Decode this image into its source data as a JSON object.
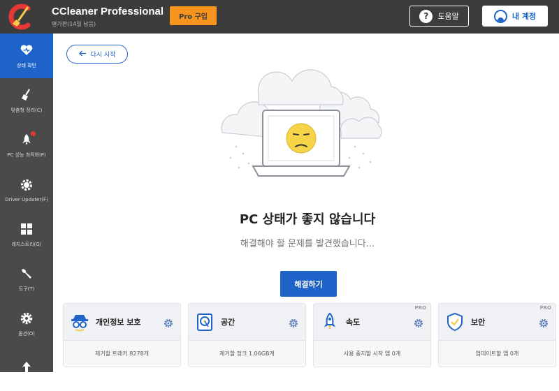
{
  "header": {
    "app_title": "CCleaner Professional",
    "subtitle": "평가판(14일 남음)",
    "pro_button": "Pro 구입",
    "help_button": "도움말",
    "account_button": "내 계정"
  },
  "sidebar": {
    "items": [
      {
        "label": "상태 확인",
        "icon": "heart-icon",
        "active": true
      },
      {
        "label": "맞춤형 정리(C)",
        "icon": "broom-icon"
      },
      {
        "label": "PC 성능 최적화(P)",
        "icon": "rocket-icon"
      },
      {
        "label": "Driver Updater(F)",
        "icon": "gear-chip-icon"
      },
      {
        "label": "레지스트리(G)",
        "icon": "grid-icon"
      },
      {
        "label": "도구(T)",
        "icon": "wrench-icon"
      },
      {
        "label": "옵션(O)",
        "icon": "settings-icon"
      },
      {
        "label": "",
        "icon": "upgrade-arrow-icon"
      }
    ]
  },
  "main": {
    "restart_button": "다시 시작",
    "status_title": "PC 상태가 좋지 않습니다",
    "status_subtitle": "해결해야 할 문제를 발견했습니다...",
    "fix_button": "해결하기"
  },
  "cards": [
    {
      "title": "개인정보 보호",
      "detail": "제거할 트래커 8278개",
      "pro": ""
    },
    {
      "title": "공간",
      "detail": "제거할 정크 1.06GB개",
      "pro": ""
    },
    {
      "title": "속도",
      "detail": "사용 중지할 시작 앱 0개",
      "pro": "PRO"
    },
    {
      "title": "보안",
      "detail": "업데이트할 앱 0개",
      "pro": "PRO"
    }
  ],
  "colors": {
    "header_bg": "#3c3c3c",
    "sidebar_bg": "#4a4a4a",
    "accent_blue": "#1e63c8",
    "pro_orange": "#f7941d"
  }
}
